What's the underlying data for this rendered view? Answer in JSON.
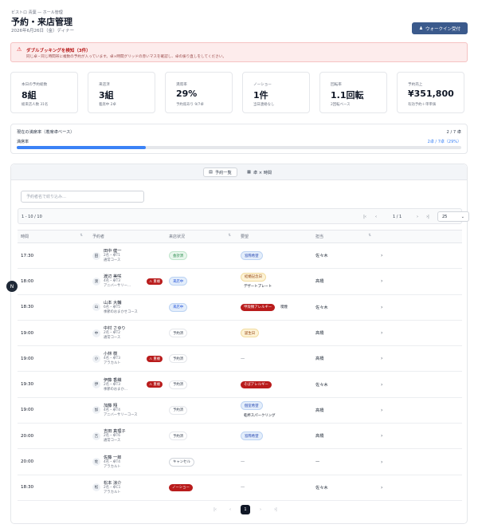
{
  "header": {
    "breadcrumb": "ビストロ 青葉 — ホール管理",
    "title": "予約・来店管理",
    "subtitle": "2026年6月26日（金）ディナー",
    "walkin_label": "ウォークイン受付"
  },
  "alert": {
    "title": "ダブルブッキングを検知（3件）",
    "body": "同じ卓・同じ時間帯に複数の予約が入っています。卓×時間グリッドの赤いマスを確認し、卓の振り直しをしてください。"
  },
  "kpis": [
    {
      "label": "本日の予約総数",
      "value": "8組",
      "sub": "総来店人数 31名"
    },
    {
      "label": "来店済",
      "value": "3組",
      "sub": "着席中 2卓"
    },
    {
      "label": "満席率",
      "value": "29%",
      "sub": "予約席あり 9/7卓"
    },
    {
      "label": "ノーショー",
      "value": "1件",
      "sub": "当日連絡なし"
    },
    {
      "label": "回転率",
      "value": "1.1回転",
      "sub": "2回転ベース"
    },
    {
      "label": "予約売上",
      "value": "¥351,800",
      "sub": "有効予約＋単単価"
    }
  ],
  "occupancy": {
    "title": "現在の満席率（着席卓ベース）",
    "right": "2 / 7 卓",
    "label": "満席率",
    "detail": "2卓 / 7卓（29%）",
    "fill_fraction": 0.29
  },
  "tabs": [
    {
      "label": "予約一覧",
      "active": true
    },
    {
      "label": "卓 × 時間",
      "active": false
    }
  ],
  "search": {
    "placeholder": "予約者名で絞り込み…"
  },
  "pager": {
    "count": "1 - 10 / 10",
    "page": "1 / 1",
    "page_size": "25"
  },
  "columns": {
    "time": "時間",
    "guest": "予約者",
    "status": "来店状況",
    "request": "要望",
    "staff": "担当"
  },
  "rows": [
    {
      "time": "17:30",
      "initial": "田",
      "name": "田中 健一",
      "meta1": "2名・卓T1",
      "meta2": "通常コース",
      "dup": "",
      "status": "会計済",
      "st": "seated",
      "req": [
        {
          "t": "窓際希望",
          "c": "blue"
        }
      ],
      "staff": "佐々木"
    },
    {
      "time": "18:00",
      "initial": "渡",
      "name": "渡辺 美咲",
      "meta1": "4名・卓T3",
      "meta2": "アニバーサリー…",
      "dup": "重複",
      "status": "来店中",
      "st": "arrived",
      "req": [
        {
          "t": "結婚記念日",
          "c": "amber"
        },
        {
          "t": "デザートプレート",
          "c": "plain"
        }
      ],
      "staff": "高橋"
    },
    {
      "time": "18:30",
      "initial": "山",
      "name": "山本 大輔",
      "meta1": "6名・卓T5",
      "meta2": "季節のおまかせコース",
      "dup": "",
      "status": "来店中",
      "st": "arrived",
      "req": [
        {
          "t": "甲殻類アレルギー",
          "c": "red"
        },
        {
          "t": "喫煙",
          "c": "plain"
        }
      ],
      "staff": "佐々木"
    },
    {
      "time": "19:00",
      "initial": "中",
      "name": "中村 さゆり",
      "meta1": "2名・卓T2",
      "meta2": "通常コース",
      "dup": "",
      "status": "予約済",
      "st": "booked",
      "req": [
        {
          "t": "誕生日",
          "c": "amber"
        }
      ],
      "staff": "高橋"
    },
    {
      "time": "19:00",
      "initial": "小",
      "name": "小林 樹",
      "meta1": "4名・卓T3",
      "meta2": "アラカルト",
      "dup": "重複",
      "status": "予約済",
      "st": "booked",
      "req": [],
      "staff": "高橋"
    },
    {
      "time": "19:30",
      "initial": "伊",
      "name": "伊藤 香織",
      "meta1": "2名・卓T3",
      "meta2": "季節のおまか…",
      "dup": "重複",
      "status": "予約済",
      "st": "booked",
      "req": [
        {
          "t": "そばアレルギー",
          "c": "red"
        }
      ],
      "staff": "佐々木"
    },
    {
      "time": "19:00",
      "initial": "加",
      "name": "加藤 翔",
      "meta1": "4名・卓T4",
      "meta2": "アニバーサリーコース",
      "dup": "",
      "status": "予約済",
      "st": "booked",
      "req": [
        {
          "t": "個室希望",
          "c": "blue"
        },
        {
          "t": "乾杯スパークリング",
          "c": "plain"
        }
      ],
      "staff": "高橋"
    },
    {
      "time": "20:00",
      "initial": "吉",
      "name": "吉田 真理子",
      "meta1": "2名・卓T6",
      "meta2": "通常コース",
      "dup": "",
      "status": "予約済",
      "st": "booked",
      "req": [
        {
          "t": "窓際希望",
          "c": "blue"
        }
      ],
      "staff": "高橋"
    },
    {
      "time": "20:00",
      "initial": "佐",
      "name": "佐藤 一郎",
      "meta1": "4名・卓T4",
      "meta2": "アラカルト",
      "dup": "",
      "status": "キャンセル",
      "st": "cancel",
      "req": [],
      "staff": "—"
    },
    {
      "time": "18:30",
      "initial": "松",
      "name": "松本 涼介",
      "meta1": "2名・卓C1",
      "meta2": "アラカルト",
      "dup": "",
      "status": "ノーショー",
      "st": "noshow",
      "req": [],
      "staff": "佐々木"
    }
  ],
  "bottom_pager": {
    "current": "1"
  },
  "colors": {
    "accent": "#3b5a8c",
    "progress": "#3b82f6",
    "danger": "#b91c1c"
  },
  "icons": {
    "walkin": "person-add-icon",
    "alert": "warning-triangle-icon",
    "list": "list-icon",
    "grid": "grid-icon",
    "help": "help-icon"
  }
}
